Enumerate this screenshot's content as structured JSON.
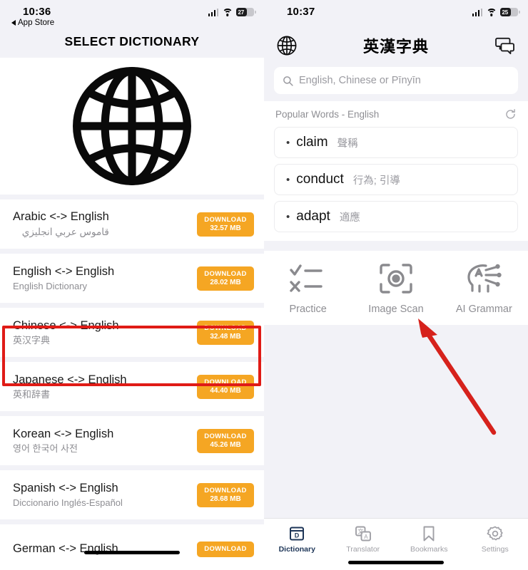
{
  "left": {
    "status": {
      "time": "10:36",
      "back_label": "App Store",
      "battery": "27"
    },
    "nav_title": "SELECT DICTIONARY",
    "logo_icon": "globe-icon",
    "download_label": "DOWNLOAD",
    "dictionaries": [
      {
        "name": "Arabic <-> English",
        "sub": "قاموس عربي انجليزي",
        "size": "32.57 MB",
        "rtl": true,
        "highlighted": false
      },
      {
        "name": "English <-> English",
        "sub": "English Dictionary",
        "size": "28.02 MB",
        "rtl": false,
        "highlighted": false
      },
      {
        "name": "Chinese <-> English",
        "sub": "英汉字典",
        "size": "32.48 MB",
        "rtl": false,
        "highlighted": true
      },
      {
        "name": "Japanese <-> English",
        "sub": "英和辞書",
        "size": "44.40 MB",
        "rtl": false,
        "highlighted": false
      },
      {
        "name": "Korean <-> English",
        "sub": "영어 한국어 사전",
        "size": "45.26 MB",
        "rtl": false,
        "highlighted": false
      },
      {
        "name": "Spanish <-> English",
        "sub": "Diccionario Inglés-Español",
        "size": "28.68 MB",
        "rtl": false,
        "highlighted": false
      },
      {
        "name": "German <-> English",
        "sub": "",
        "size": "DOWNLOAD",
        "rtl": false,
        "highlighted": false
      }
    ]
  },
  "right": {
    "status": {
      "time": "10:37",
      "battery": "25"
    },
    "nav": {
      "title": "英漢字典",
      "left_icon": "globe-icon",
      "right_icon": "chat-bubbles-icon"
    },
    "search": {
      "placeholder": "English, Chinese or Pīnyīn",
      "value": "",
      "icon": "search-icon"
    },
    "popular": {
      "label": "Popular Words - English",
      "refresh_icon": "refresh-icon",
      "words": [
        {
          "en": "claim",
          "zh": "聲稱"
        },
        {
          "en": "conduct",
          "zh": "行為; 引導"
        },
        {
          "en": "adapt",
          "zh": "適應"
        }
      ]
    },
    "tools": [
      {
        "label": "Practice",
        "icon": "check-cross-list-icon"
      },
      {
        "label": "Image Scan",
        "icon": "scan-focus-icon"
      },
      {
        "label": "AI Grammar",
        "icon": "ai-head-icon"
      }
    ],
    "tabs": [
      {
        "label": "Dictionary",
        "icon": "dictionary-book-icon",
        "active": true
      },
      {
        "label": "Translator",
        "icon": "translate-icon",
        "active": false
      },
      {
        "label": "Bookmarks",
        "icon": "bookmark-icon",
        "active": false
      },
      {
        "label": "Settings",
        "icon": "gear-icon",
        "active": false
      }
    ]
  },
  "annotations": {
    "highlight_color": "#e01b16",
    "arrow_color": "#d6221c",
    "accent_orange": "#f5a623"
  }
}
